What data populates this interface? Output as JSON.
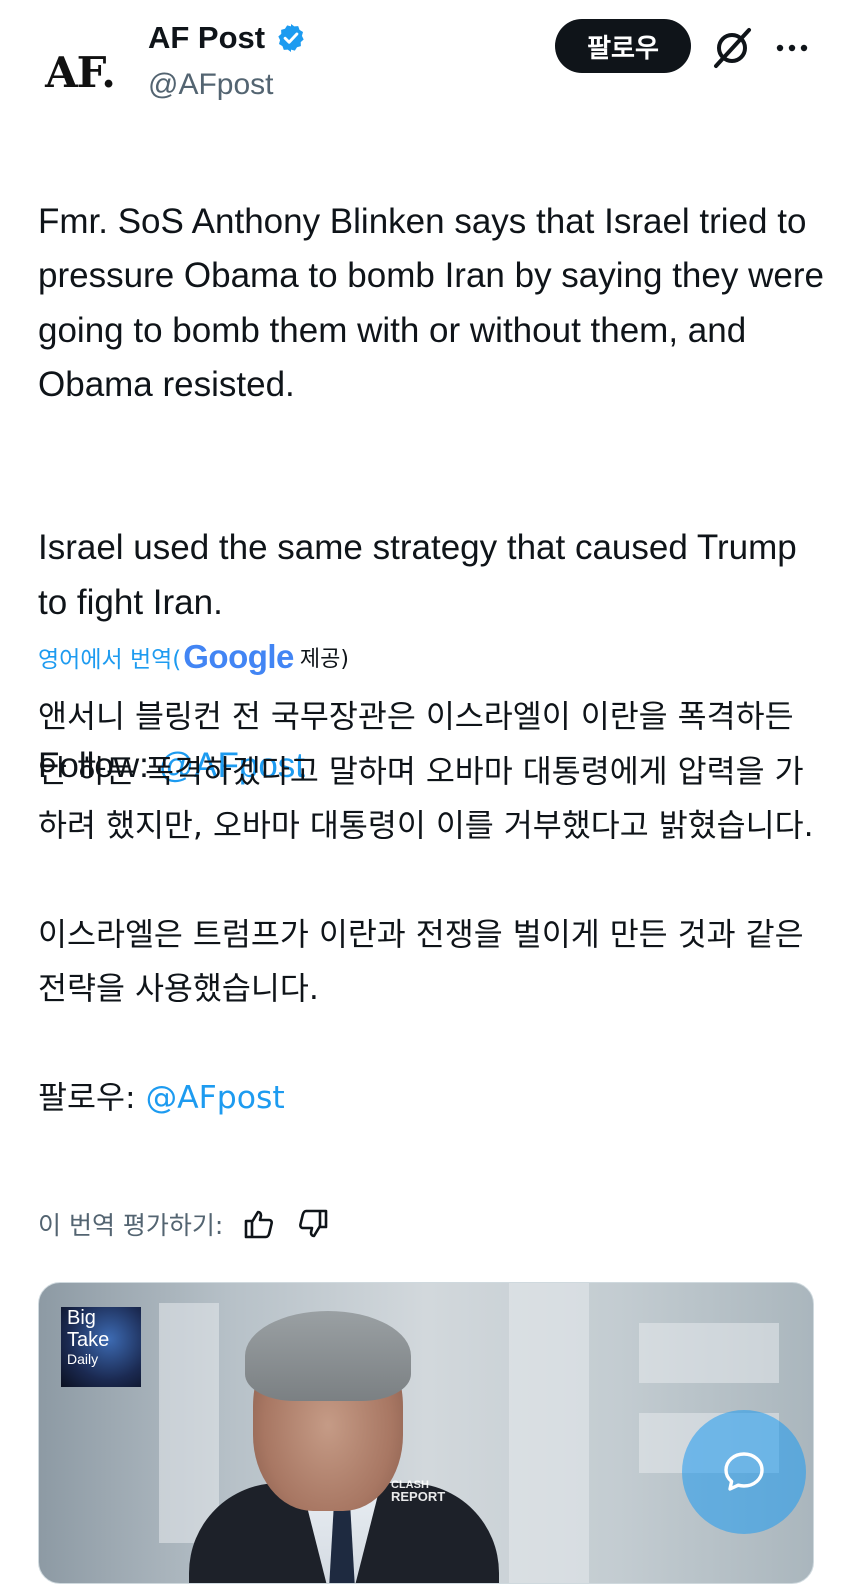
{
  "header": {
    "avatar_text": "AF.",
    "name": "AF Post",
    "handle": "@AFpost",
    "follow_label": "팔로우",
    "grok_icon": "grok-slash-icon",
    "more_icon": "more-dots-icon"
  },
  "tweet": {
    "para1": "Fmr. SoS Anthony Blinken says that Israel tried to pressure Obama to bomb Iran by saying they were going to bomb them with or without them, and Obama resisted.",
    "para2": "Israel used the same strategy that caused Trump to fight Iran.",
    "follow_prefix": "Follow: ",
    "follow_handle": "@AFpost"
  },
  "translation": {
    "label": "영어에서 번역(",
    "provider": "Google",
    "provided": " 제공)",
    "para1": "앤서니 블링컨 전 국무장관은 이스라엘이 이란을 폭격하든 안 하든 폭격하겠다고 말하며 오바마 대통령에게 압력을 가하려 했지만, 오바마 대통령이 이를 거부했다고 밝혔습니다.",
    "para2": "이스라엘은 트럼프가 이란과 전쟁을 벌이게 만든 것과 같은 전략을 사용했습니다.",
    "follow_prefix": "팔로우: ",
    "follow_handle": "@AFpost",
    "rate_label": "이 번역 평가하기:"
  },
  "media": {
    "podcast_line1": "Big",
    "podcast_line2": "Take",
    "podcast_line3": "Daily",
    "watermark_line1": "CLASH",
    "watermark_line2": "REPORT"
  },
  "colors": {
    "link": "#1d9bf0",
    "text": "#0f1419",
    "muted": "#536471"
  }
}
